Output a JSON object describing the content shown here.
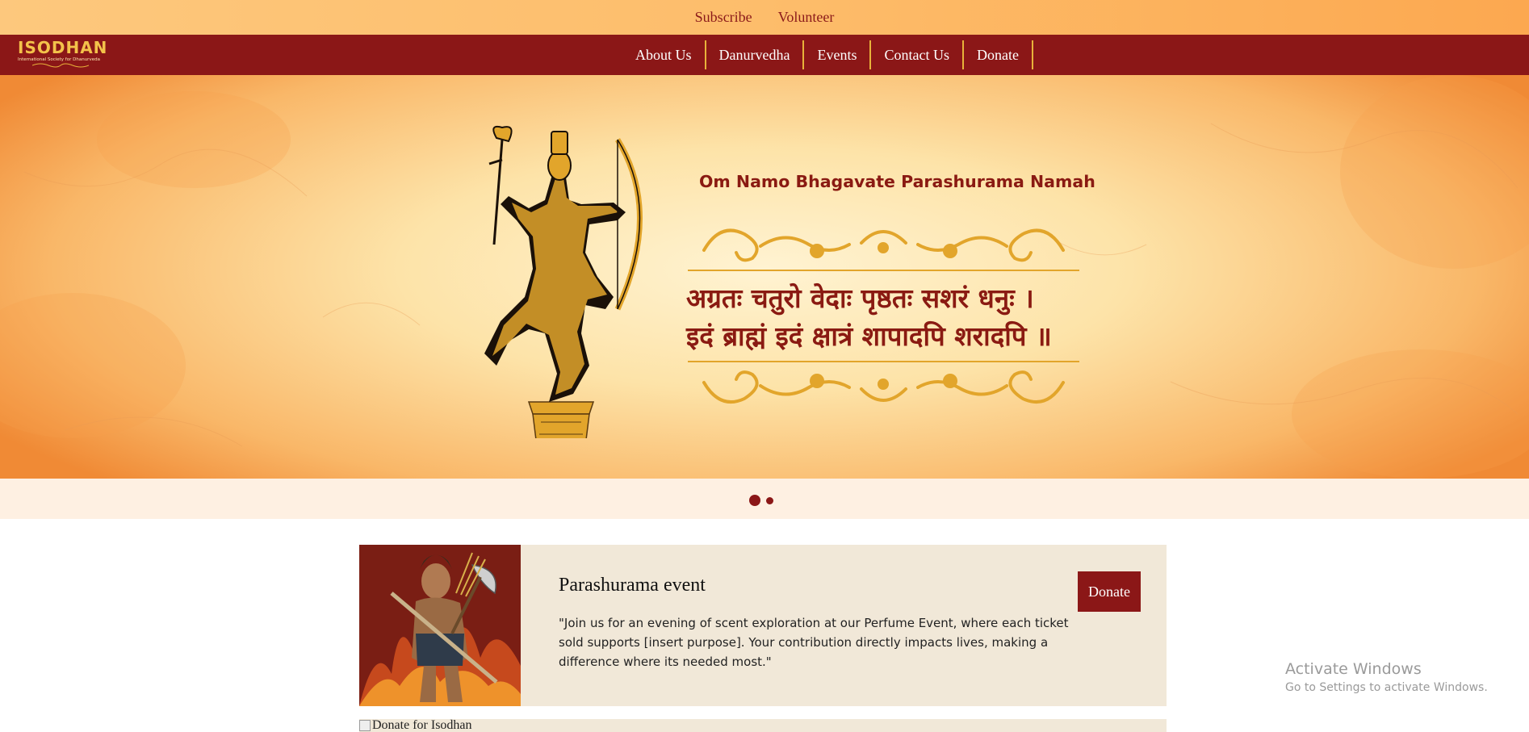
{
  "topbar": {
    "links": [
      {
        "label": "Subscribe"
      },
      {
        "label": "Volunteer"
      }
    ]
  },
  "brand": {
    "logo_title": "ISODHAN",
    "logo_subtitle": "International Society for Dhanurveda"
  },
  "nav": {
    "items": [
      {
        "label": "About Us"
      },
      {
        "label": "Danurvedha"
      },
      {
        "label": "Events"
      },
      {
        "label": "Contact Us"
      },
      {
        "label": "Donate"
      }
    ]
  },
  "hero": {
    "title": "Om Namo Bhagavate Parashurama Namah",
    "shloka_line1": "अग्रतः चतुरो वेदाः पृष्ठतः सशरं धनुः ।",
    "shloka_line2": "इदं ब्राह्मं इदं क्षात्रं शापादपि शरादपि ॥",
    "colors": {
      "accent": "#8b1717",
      "gold": "#e2a52b"
    }
  },
  "carousel": {
    "slide_count": 2,
    "active_slide": 1
  },
  "event": {
    "title": "Parashurama event",
    "description": "\"Join us for an evening of scent exploration at our Perfume Event, where each ticket sold supports [insert purpose]. Your contribution directly impacts lives, making a difference where its needed most.\"",
    "donate_label": "Donate"
  },
  "donate_card": {
    "image_alt": "Donate for Isodhan"
  },
  "watermark": {
    "line1": "Activate Windows",
    "line2": "Go to Settings to activate Windows."
  }
}
